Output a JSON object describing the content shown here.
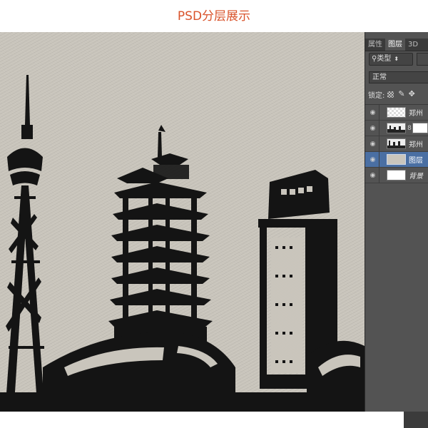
{
  "page_title": "PSD分层展示",
  "panel": {
    "tabs": [
      {
        "label": "属性",
        "active": false
      },
      {
        "label": "图层",
        "active": true
      },
      {
        "label": "3D",
        "active": false
      }
    ],
    "filter": {
      "icon": "search-icon",
      "label": "类型",
      "chevron": "⬍"
    },
    "blend_mode": "正常",
    "lock": {
      "label": "锁定:",
      "icons": [
        "checkerboard-icon",
        "brush-icon",
        "move-icon"
      ]
    },
    "layers": [
      {
        "name": "郑州",
        "thumb": "transparent",
        "has_mask": false,
        "selected": false
      },
      {
        "name": "",
        "thumb": "skyline",
        "has_mask": true,
        "selected": false
      },
      {
        "name": "郑州",
        "thumb": "skyline",
        "has_mask": false,
        "selected": false
      },
      {
        "name": "图层",
        "thumb": "beige",
        "has_mask": false,
        "selected": true
      },
      {
        "name": "背景",
        "thumb": "white",
        "has_mask": false,
        "selected": false,
        "italic": true
      }
    ]
  },
  "colors": {
    "title": "#d9532b",
    "canvas": "#c9c5bc",
    "panel": "#535353",
    "selected_layer": "#4a6fa3"
  }
}
